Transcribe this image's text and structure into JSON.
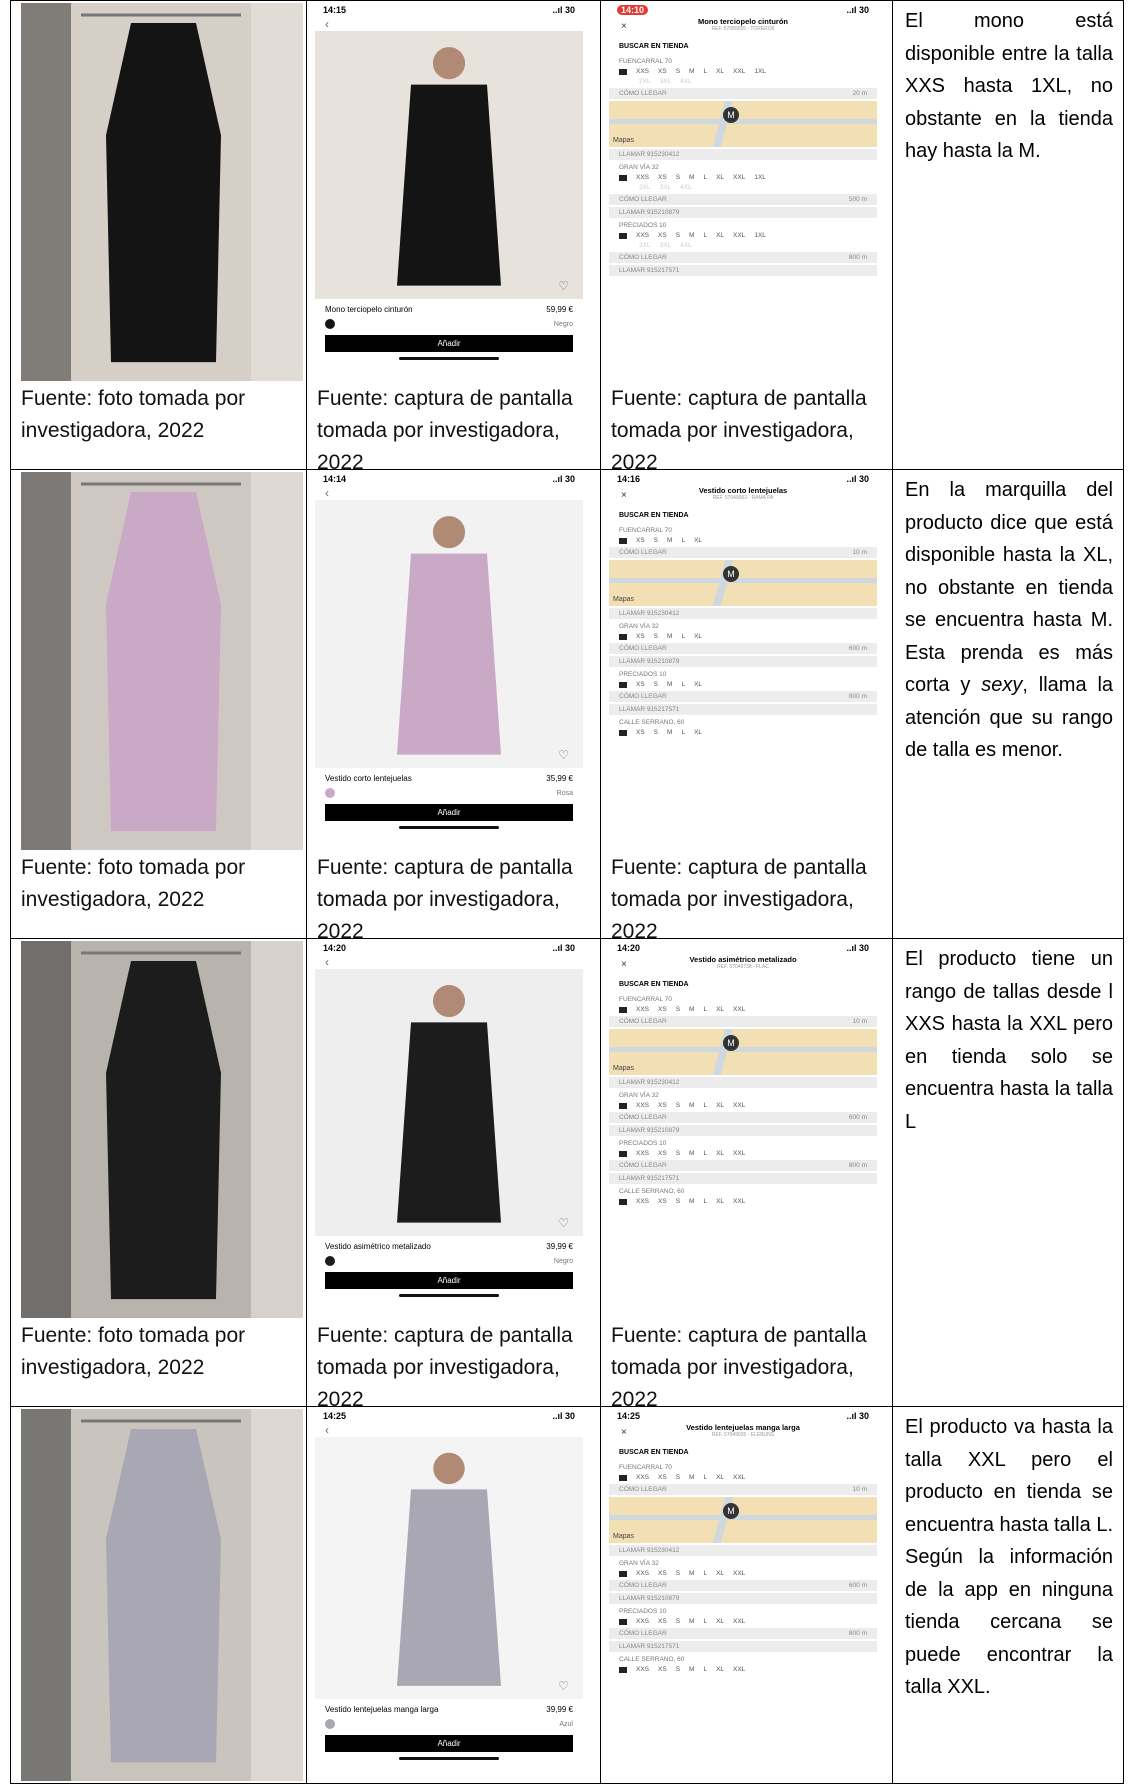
{
  "rows": [
    {
      "photo_caption": "Fuente: foto tomada por investigadora, 2022",
      "app_caption": "Fuente: captura de pantalla tomada por investigadora, 2022",
      "store_caption": "Fuente: captura de pantalla tomada por investigadora, 2022",
      "description": "El mono está disponible entre la talla XXS hasta 1XL, no obstante en la tienda hay hasta la M.",
      "colors": {
        "garment": "#141414",
        "photo_bg": "#d6cfc7",
        "model_bg": "#e7e2dc"
      },
      "phone": {
        "time": "14:15",
        "signal": "..ıl 30",
        "product": "Mono terciopelo cinturón",
        "price": "59,99 €",
        "color_name": "Negro",
        "add": "Añadir"
      },
      "stores": {
        "time": "14:10",
        "title": "Mono terciopelo cinturón",
        "ref": "REF. 57089055 - TORERO6",
        "buscar": "BUSCAR EN TIENDA",
        "list": [
          {
            "name": "FUENCARRAL 70",
            "sizes": [
              "XXS",
              "XS",
              "S",
              "M",
              "L",
              "XL",
              "XXL",
              "1XL"
            ],
            "extra": [
              "2XL",
              "3XL",
              "4XL"
            ],
            "llegar": "CÓMO LLEGAR",
            "dist": "20 m",
            "llamar": "LLAMAR 915230412",
            "map": true
          },
          {
            "name": "GRAN VÍA 32",
            "sizes": [
              "XXS",
              "XS",
              "S",
              "M",
              "L",
              "XL",
              "XXL",
              "1XL"
            ],
            "extra": [
              "2XL",
              "3XL",
              "4XL"
            ],
            "llegar": "CÓMO LLEGAR",
            "dist": "500 m",
            "llamar": "LLAMAR 915210879"
          },
          {
            "name": "PRECIADOS 10",
            "sizes": [
              "XXS",
              "XS",
              "S",
              "M",
              "L",
              "XL",
              "XXL",
              "1XL"
            ],
            "extra": [
              "2XL",
              "3XL",
              "4XL"
            ],
            "llegar": "CÓMO LLEGAR",
            "dist": "800 m",
            "llamar": "LLAMAR 915217571"
          }
        ]
      }
    },
    {
      "photo_caption": "Fuente: foto tomada por investigadora, 2022",
      "app_caption": "Fuente: captura de pantalla tomada por investigadora, 2022",
      "store_caption": "Fuente: captura de pantalla tomada por investigadora, 2022",
      "description_parts": [
        "En la marquilla del producto dice que está disponible hasta la XL, no obstante en tienda se encuentra hasta M. Esta prenda es más corta y ",
        "sexy",
        ", llama la atención que su rango de talla es menor."
      ],
      "colors": {
        "garment": "#c9a9c6",
        "photo_bg": "#cfc8c2",
        "model_bg": "#f2f2f2"
      },
      "phone": {
        "time": "14:14",
        "signal": "..ıl 30",
        "product": "Vestido corto lentejuelas",
        "price": "35,99 €",
        "color_name": "Rosa",
        "add": "Añadir"
      },
      "stores": {
        "time": "14:16",
        "title": "Vestido corto lentejuelas",
        "ref": "REF. 57049063 - RAMA PA",
        "buscar": "BUSCAR EN TIENDA",
        "list": [
          {
            "name": "FUENCARRAL 70",
            "sizes": [
              "XS",
              "S",
              "M",
              "L",
              "XL"
            ],
            "llegar": "CÓMO LLEGAR",
            "dist": "10 m",
            "llamar": "LLAMAR 915230412",
            "map": true
          },
          {
            "name": "GRAN VÍA 32",
            "sizes": [
              "XS",
              "S",
              "M",
              "L",
              "XL"
            ],
            "llegar": "CÓMO LLEGAR",
            "dist": "600 m",
            "llamar": "LLAMAR 915210879"
          },
          {
            "name": "PRECIADOS 10",
            "sizes": [
              "XS",
              "S",
              "M",
              "L",
              "XL"
            ],
            "llegar": "CÓMO LLEGAR",
            "dist": "800 m",
            "llamar": "LLAMAR 915217571"
          },
          {
            "name": "CALLE SERRANO, 60",
            "sizes": [
              "XS",
              "S",
              "M",
              "L",
              "XL"
            ]
          }
        ]
      }
    },
    {
      "photo_caption": "Fuente: foto tomada por investigadora, 2022",
      "app_caption": "Fuente: captura de pantalla tomada por investigadora, 2022",
      "store_caption": "Fuente: captura de pantalla tomada por investigadora, 2022",
      "description": "El producto tiene un rango de tallas desde l XXS hasta la XXL pero en tienda solo se encuentra hasta la talla L",
      "colors": {
        "garment": "#1c1c1c",
        "photo_bg": "#b9b3ad",
        "model_bg": "#eeeeee"
      },
      "phone": {
        "time": "14:20",
        "signal": "..ıl 30",
        "product": "Vestido asimétrico metalizado",
        "price": "39,99 €",
        "color_name": "Negro",
        "add": "Añadir"
      },
      "stores": {
        "time": "14:20",
        "title": "Vestido asimétrico metalizado",
        "ref": "REF. 57049738 - FLAC",
        "buscar": "BUSCAR EN TIENDA",
        "list": [
          {
            "name": "FUENCARRAL 70",
            "sizes": [
              "XXS",
              "XS",
              "S",
              "M",
              "L",
              "XL",
              "XXL"
            ],
            "llegar": "CÓMO LLEGAR",
            "dist": "10 m",
            "llamar": "LLAMAR 915230412",
            "map": true
          },
          {
            "name": "GRAN VÍA 32",
            "sizes": [
              "XXS",
              "XS",
              "S",
              "M",
              "L",
              "XL",
              "XXL"
            ],
            "llegar": "CÓMO LLEGAR",
            "dist": "600 m",
            "llamar": "LLAMAR 915210879"
          },
          {
            "name": "PRECIADOS 10",
            "sizes": [
              "XXS",
              "XS",
              "S",
              "M",
              "L",
              "XL",
              "XXL"
            ],
            "llegar": "CÓMO LLEGAR",
            "dist": "800 m",
            "llamar": "LLAMAR 915217571"
          },
          {
            "name": "CALLE SERRANO, 60",
            "sizes": [
              "XXS",
              "XS",
              "S",
              "M",
              "L",
              "XL",
              "XXL"
            ]
          }
        ]
      }
    },
    {
      "photo_caption": "",
      "description": "El producto va hasta la talla XXL pero el producto en tienda se encuentra hasta talla L. Según la información de la app en ninguna tienda cercana se puede encontrar la talla XXL.",
      "colors": {
        "garment": "#a9a7b4",
        "photo_bg": "#c9c4be",
        "model_bg": "#f4f4f4"
      },
      "phone": {
        "time": "14:25",
        "signal": "..ıl 30",
        "product": "Vestido lentejuelas manga larga",
        "price": "39,99 €",
        "color_name": "Azul",
        "add": "Añadir"
      },
      "stores": {
        "time": "14:25",
        "title": "Vestido lentejuelas manga larga",
        "ref": "REF. 57049035 - ELEBUNS",
        "buscar": "BUSCAR EN TIENDA",
        "list": [
          {
            "name": "FUENCARRAL 70",
            "sizes": [
              "XXS",
              "XS",
              "S",
              "M",
              "L",
              "XL",
              "XXL"
            ],
            "llegar": "CÓMO LLEGAR",
            "dist": "10 m",
            "llamar": "LLAMAR 915230412",
            "map": true
          },
          {
            "name": "GRAN VÍA 32",
            "sizes": [
              "XXS",
              "XS",
              "S",
              "M",
              "L",
              "XL",
              "XXL"
            ],
            "llegar": "CÓMO LLEGAR",
            "dist": "600 m",
            "llamar": "LLAMAR 915210879"
          },
          {
            "name": "PRECIADOS 10",
            "sizes": [
              "XXS",
              "XS",
              "S",
              "M",
              "L",
              "XL",
              "XXL"
            ],
            "llegar": "CÓMO LLEGAR",
            "dist": "800 m",
            "llamar": "LLAMAR 915217571"
          },
          {
            "name": "CALLE SERRANO, 60",
            "sizes": [
              "XXS",
              "XS",
              "S",
              "M",
              "L",
              "XL",
              "XXL"
            ]
          }
        ]
      }
    }
  ],
  "map_label": "Mapas"
}
